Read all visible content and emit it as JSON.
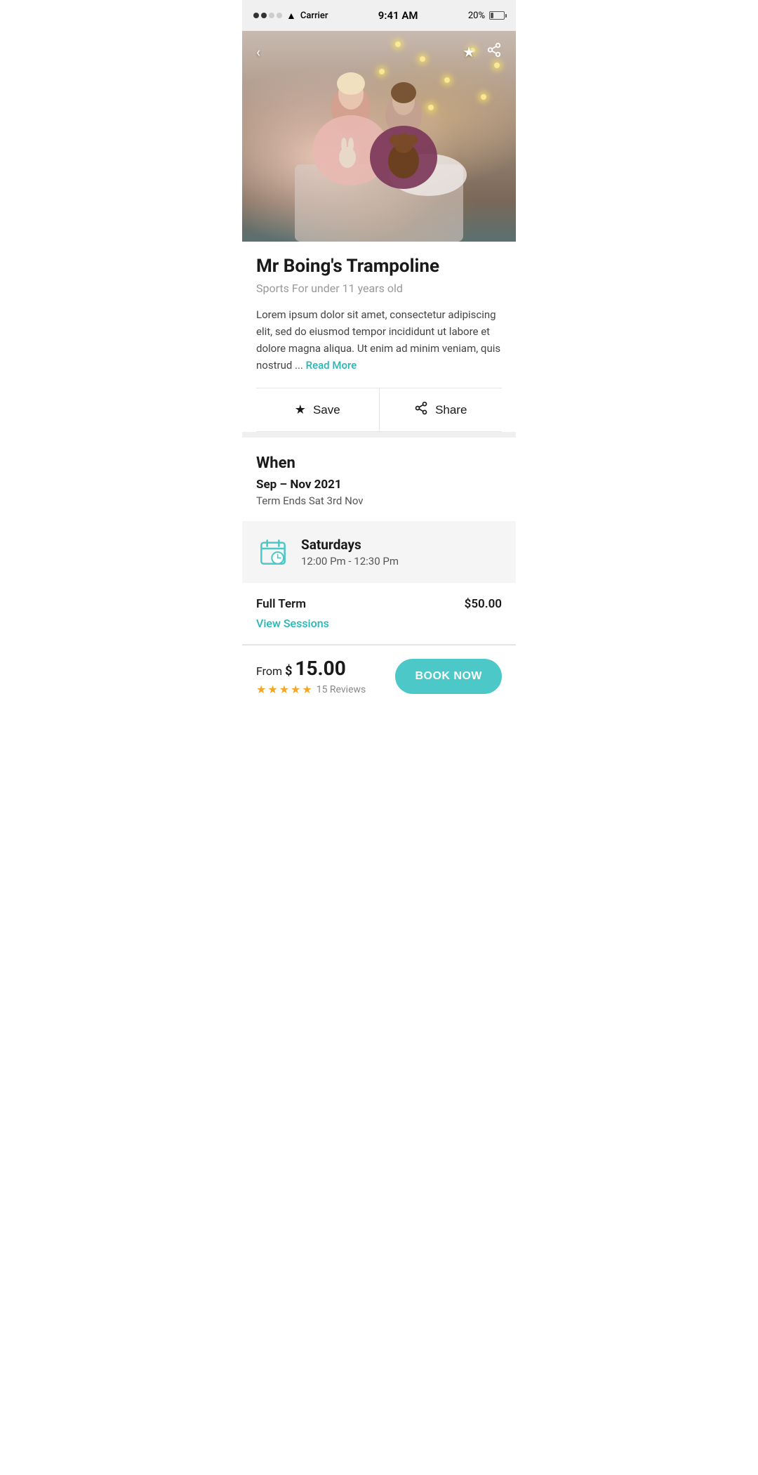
{
  "statusBar": {
    "carrier": "Carrier",
    "time": "9:41 AM",
    "battery": "20%",
    "signal": [
      true,
      true,
      false,
      false
    ]
  },
  "nav": {
    "backIcon": "‹",
    "starIcon": "★",
    "shareIcon": "⤴"
  },
  "hero": {
    "altText": "Two young girls sitting on a bed with stuffed animals and fairy lights"
  },
  "venue": {
    "title": "Mr Boing's Trampoline",
    "subtitle": "Sports For under 11 years old",
    "description": "Lorem ipsum dolor sit amet, consectetur adipiscing elit, sed do eiusmod tempor incididunt ut labore et dolore magna aliqua. Ut enim ad minim veniam, quis nostrud ...",
    "readMore": "Read More"
  },
  "actions": {
    "save": "Save",
    "share": "Share"
  },
  "when": {
    "sectionTitle": "When",
    "dateRange": "Sep – Nov 2021",
    "termEnds": "Term Ends Sat 3rd Nov"
  },
  "schedule": {
    "day": "Saturdays",
    "timeStart": "12:00 Pm",
    "timeSep": " - ",
    "timeEnd": "12:30 Pm",
    "timeDisplay": "12:00 Pm - 12:30 Pm"
  },
  "pricing": {
    "label": "Full Term",
    "amount": "$50.00",
    "viewSessions": "View Sessions"
  },
  "bottomBar": {
    "fromText": "From",
    "dollarSign": "$ ",
    "price": "15.00",
    "starCount": 5,
    "reviewCount": "15 Reviews",
    "bookNow": "BOOK NOW"
  },
  "colors": {
    "teal": "#4cc8c8",
    "star": "#f5a623",
    "readMore": "#2ab5b5"
  }
}
